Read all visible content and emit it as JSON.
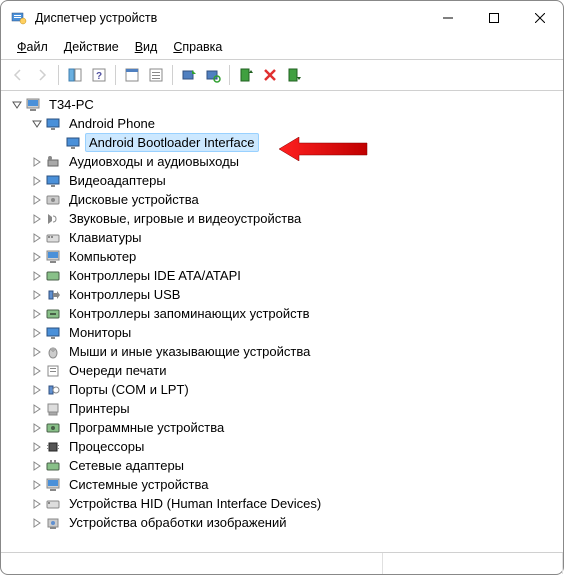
{
  "window": {
    "title": "Диспетчер устройств"
  },
  "menus": {
    "file": "Файл",
    "action": "Действие",
    "view": "Вид",
    "help": "Справка"
  },
  "tree": {
    "root": "T34-PC",
    "android_phone": "Android Phone",
    "android_bootloader": "Android Bootloader Interface",
    "items": [
      "Аудиовходы и аудиовыходы",
      "Видеоадаптеры",
      "Дисковые устройства",
      "Звуковые, игровые и видеоустройства",
      "Клавиатуры",
      "Компьютер",
      "Контроллеры IDE ATA/ATAPI",
      "Контроллеры USB",
      "Контроллеры запоминающих устройств",
      "Мониторы",
      "Мыши и иные указывающие устройства",
      "Очереди печати",
      "Порты (COM и LPT)",
      "Принтеры",
      "Программные устройства",
      "Процессоры",
      "Сетевые адаптеры",
      "Системные устройства",
      "Устройства HID (Human Interface Devices)",
      "Устройства обработки изображений"
    ]
  }
}
